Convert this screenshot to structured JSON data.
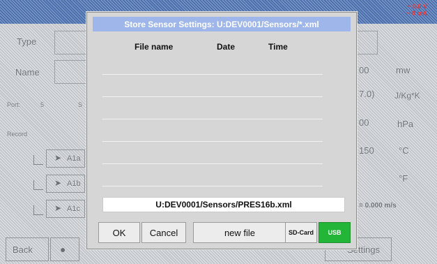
{
  "status": {
    "line1": "~ 0.0 V",
    "line2": "~ 0 mA"
  },
  "background": {
    "type_label": "Type",
    "name_label": "Name",
    "port_label": "Port:",
    "port_value": "5",
    "port_extra": "S",
    "record_label": "Record",
    "channels": [
      {
        "label": "A1a"
      },
      {
        "label": "A1b"
      },
      {
        "label": "A1c"
      }
    ],
    "right_values": [
      "00",
      "7.0)",
      "00",
      "150"
    ],
    "right_units": [
      "mw",
      "J/Kg*K",
      "hPa",
      "°C",
      "°F"
    ],
    "value_line": "= 0.000 m/s",
    "back_button": "Back",
    "settings_button": "Settings"
  },
  "dialog": {
    "title": "Store Sensor Settings:  U:DEV0001/Sensors/*.xml",
    "columns": {
      "file_name": "File name",
      "date": "Date",
      "time": "Time"
    },
    "rows": 6,
    "filename": "U:DEV0001/Sensors/PRES16b.xml",
    "buttons": {
      "ok": "OK",
      "cancel": "Cancel",
      "new_file": "new file",
      "sd_card": "SD-Card",
      "usb": "USB"
    },
    "colors": {
      "title_bg": "#9fb6ea",
      "usb_bg": "#22b537"
    }
  }
}
